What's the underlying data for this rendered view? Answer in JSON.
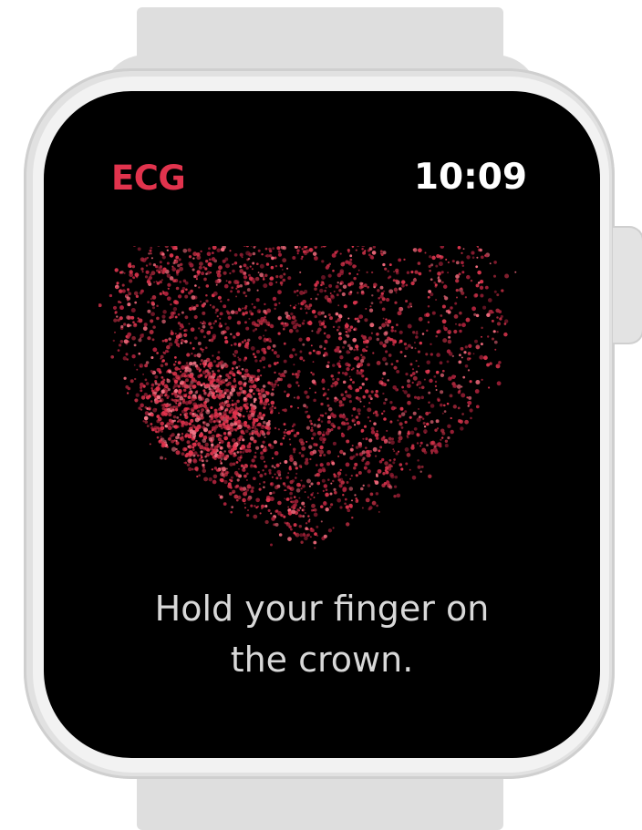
{
  "watch": {
    "app_title": "ECG",
    "time": "10:09",
    "instruction_line1": "Hold your finger on",
    "instruction_line2": "the crown.",
    "accent_color": "#e1334d",
    "graphic_icon": "particle-heart-icon"
  }
}
